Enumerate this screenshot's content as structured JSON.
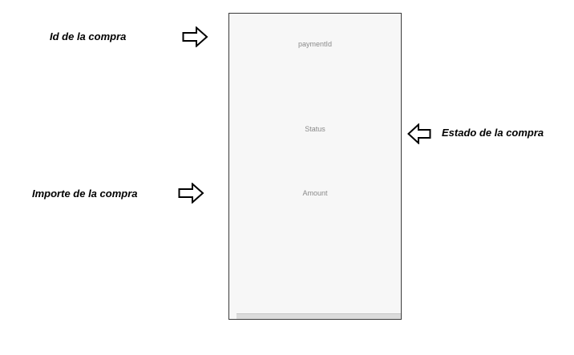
{
  "annotations": {
    "payment_id": "Id de la compra",
    "status": "Estado de la compra",
    "amount": "Importe de la compra"
  },
  "screen": {
    "payment_id_label": "paymentId",
    "status_label": "Status",
    "amount_label": "Amount"
  },
  "icons": {
    "arrow_right": "arrow-right-outline-icon",
    "arrow_left": "arrow-left-outline-icon"
  },
  "colors": {
    "screen_background": "#f7f7f7",
    "placeholder_text": "#8a8a8a",
    "annotation_text": "#000000"
  }
}
